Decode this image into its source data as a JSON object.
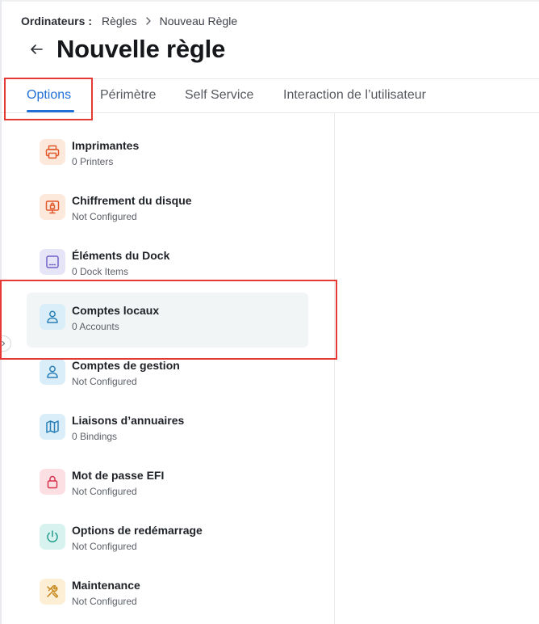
{
  "breadcrumb": {
    "root": "Ordinateurs",
    "separator": ":",
    "item1": "Règles",
    "item2": "Nouveau Règle"
  },
  "page": {
    "title": "Nouvelle règle"
  },
  "tabs": [
    {
      "label": "Options",
      "active": true
    },
    {
      "label": "Périmètre",
      "active": false
    },
    {
      "label": "Self Service",
      "active": false
    },
    {
      "label": "Interaction de l’utilisateur",
      "active": false
    }
  ],
  "items": [
    {
      "title": "Imprimantes",
      "subtitle": "0 Printers",
      "icon": "printer-icon",
      "icon_bg": "#fde8dc",
      "icon_color": "#e0592a"
    },
    {
      "title": "Chiffrement du disque",
      "subtitle": "Not Configured",
      "icon": "disk-encryption-icon",
      "icon_bg": "#fde8dc",
      "icon_color": "#e0592a"
    },
    {
      "title": "Éléments du Dock",
      "subtitle": "0 Dock Items",
      "icon": "dock-icon",
      "icon_bg": "#e6e4f7",
      "icon_color": "#6f63c9"
    },
    {
      "title": "Comptes locaux",
      "subtitle": "0 Accounts",
      "icon": "user-icon",
      "icon_bg": "#d9eef8",
      "icon_color": "#2a7fb8",
      "selected": true
    },
    {
      "title": "Comptes de gestion",
      "subtitle": "Not Configured",
      "icon": "user-icon",
      "icon_bg": "#d9eef8",
      "icon_color": "#2a7fb8"
    },
    {
      "title": "Liaisons d’annuaires",
      "subtitle": "0 Bindings",
      "icon": "map-icon",
      "icon_bg": "#d9eef8",
      "icon_color": "#2a7fb8"
    },
    {
      "title": "Mot de passe EFI",
      "subtitle": "Not Configured",
      "icon": "lock-icon",
      "icon_bg": "#fcdfe3",
      "icon_color": "#d8344f"
    },
    {
      "title": "Options de redémarrage",
      "subtitle": "Not Configured",
      "icon": "power-icon",
      "icon_bg": "#d8f3ef",
      "icon_color": "#1f9c8a"
    },
    {
      "title": "Maintenance",
      "subtitle": "Not Configured",
      "icon": "tools-icon",
      "icon_bg": "#fcefd6",
      "icon_color": "#c7861a"
    }
  ],
  "colors": {
    "accent": "#1f6fd6",
    "highlight_box": "#e53935"
  }
}
